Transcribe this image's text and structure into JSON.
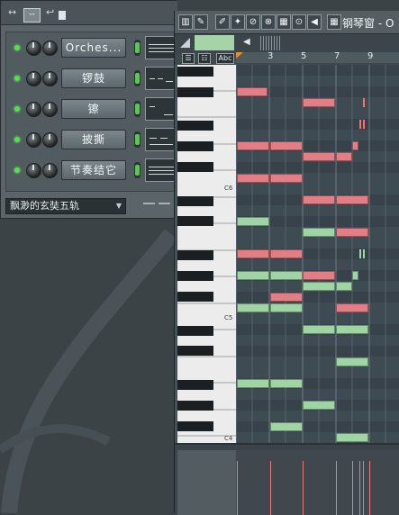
{
  "rack": {
    "arrow_label": "↔",
    "view_label": "--",
    "channels": [
      {
        "name": "Orches..."
      },
      {
        "name": "锣鼓"
      },
      {
        "name": "镲"
      },
      {
        "name": "披撕"
      },
      {
        "name": "节奏结它"
      }
    ],
    "pattern_name": "飘渺的玄奘五轨"
  },
  "piano_roll": {
    "title": "钢琴窗 - O",
    "snap_label": "Abc",
    "ruler_numbers": [
      "3",
      "5",
      "7",
      "9"
    ],
    "key_labels": [
      "C6",
      "C5",
      "C4"
    ]
  },
  "colors": {
    "note_primary": "#e37e86",
    "note_secondary": "#9fd4a5",
    "playhead": "#e98c2d"
  }
}
